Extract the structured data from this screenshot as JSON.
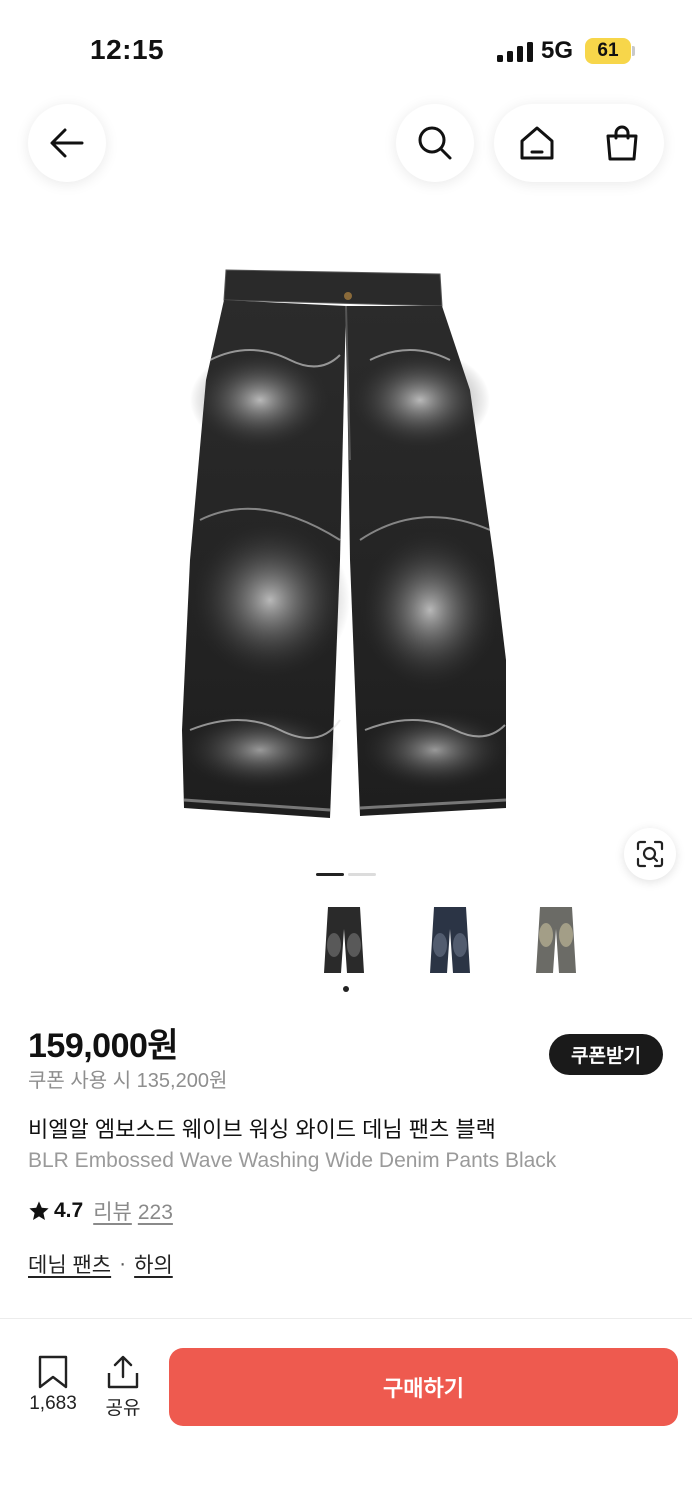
{
  "status_bar": {
    "time": "12:15",
    "network": "5G",
    "battery": "61",
    "battery_color": "#f7d64a"
  },
  "nav": {
    "back_icon": "arrow-left-icon",
    "search_icon": "search-icon",
    "home_icon": "home-icon",
    "cart_icon": "shopping-bag-icon"
  },
  "gallery": {
    "active_index": 0,
    "page_count": 2,
    "thumbnails": [
      {
        "color": "black"
      },
      {
        "color": "navy"
      },
      {
        "color": "grey"
      }
    ],
    "lens_icon": "visual-search-icon"
  },
  "product": {
    "price": "159,000원",
    "coupon_price": "쿠폰 사용 시 135,200원",
    "coupon_button": "쿠폰받기",
    "title_ko": "비엘알 엠보스드 웨이브 워싱 와이드 데님 팬츠 블랙",
    "title_en": "BLR Embossed Wave Washing Wide Denim Pants Black",
    "rating": "4.7",
    "review_label": "리뷰",
    "review_count": "223",
    "categories": [
      "데님 팬츠",
      "하의"
    ],
    "category_separator": "·"
  },
  "bottom_bar": {
    "bookmark_count": "1,683",
    "share_label": "공유",
    "buy_label": "구매하기",
    "buy_color": "#ee5a4f"
  }
}
